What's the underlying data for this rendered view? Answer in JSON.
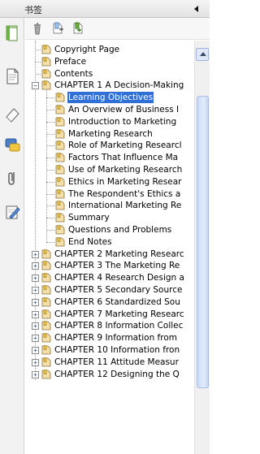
{
  "panel": {
    "title": "书签"
  },
  "side_tools": [
    {
      "name": "pages-icon"
    },
    {
      "name": "page-thumbnails-icon"
    },
    {
      "name": "signatures-icon"
    },
    {
      "name": "comments-icon"
    },
    {
      "name": "attachments-icon"
    },
    {
      "name": "edit-notes-icon"
    }
  ],
  "toolbar": [
    {
      "name": "delete-bookmark-icon"
    },
    {
      "name": "new-bookmark-icon"
    },
    {
      "name": "expand-bookmark-icon"
    }
  ],
  "colors": {
    "selection": "#2f6fd6",
    "bookmark_page": "#f4dfa8",
    "bookmark_flag": "#e7c34c"
  },
  "bookmarks": [
    {
      "label": "Copyright Page",
      "level": 0,
      "expandable": false
    },
    {
      "label": "Preface",
      "level": 0,
      "expandable": false
    },
    {
      "label": "Contents",
      "level": 0,
      "expandable": false
    },
    {
      "label": "CHAPTER 1 A Decision-Making",
      "level": 0,
      "expandable": true,
      "expanded": true
    },
    {
      "label": "Learning Objectives",
      "level": 1,
      "expandable": false,
      "selected": true
    },
    {
      "label": "An Overview of Business I",
      "level": 1,
      "expandable": false
    },
    {
      "label": "Introduction to Marketing",
      "level": 1,
      "expandable": false
    },
    {
      "label": "Marketing Research",
      "level": 1,
      "expandable": false
    },
    {
      "label": "Role of Marketing Researcl",
      "level": 1,
      "expandable": false
    },
    {
      "label": "Factors That Influence Ma",
      "level": 1,
      "expandable": false
    },
    {
      "label": "Use of Marketing Research",
      "level": 1,
      "expandable": false
    },
    {
      "label": "Ethics in Marketing Resear",
      "level": 1,
      "expandable": false
    },
    {
      "label": "The Respondent's Ethics a",
      "level": 1,
      "expandable": false
    },
    {
      "label": "International Marketing Re",
      "level": 1,
      "expandable": false
    },
    {
      "label": "Summary",
      "level": 1,
      "expandable": false
    },
    {
      "label": "Questions and Problems",
      "level": 1,
      "expandable": false
    },
    {
      "label": "End Notes",
      "level": 1,
      "expandable": false
    },
    {
      "label": "CHAPTER 2 Marketing Researc",
      "level": 0,
      "expandable": true,
      "expanded": false
    },
    {
      "label": "CHAPTER 3 The Marketing Re",
      "level": 0,
      "expandable": true,
      "expanded": false
    },
    {
      "label": "CHAPTER 4 Research Design a",
      "level": 0,
      "expandable": true,
      "expanded": false
    },
    {
      "label": "CHAPTER 5 Secondary Source",
      "level": 0,
      "expandable": true,
      "expanded": false
    },
    {
      "label": "CHAPTER 6 Standardized Sou",
      "level": 0,
      "expandable": true,
      "expanded": false
    },
    {
      "label": "CHAPTER 7 Marketing Researc",
      "level": 0,
      "expandable": true,
      "expanded": false
    },
    {
      "label": "CHAPTER 8 Information Collec",
      "level": 0,
      "expandable": true,
      "expanded": false
    },
    {
      "label": "CHAPTER 9 Information from",
      "level": 0,
      "expandable": true,
      "expanded": false
    },
    {
      "label": "CHAPTER 10 Information fron",
      "level": 0,
      "expandable": true,
      "expanded": false
    },
    {
      "label": "CHAPTER 11 Attitude Measur",
      "level": 0,
      "expandable": true,
      "expanded": false
    },
    {
      "label": "CHAPTER 12 Designing the Q",
      "level": 0,
      "expandable": true,
      "expanded": false
    }
  ]
}
